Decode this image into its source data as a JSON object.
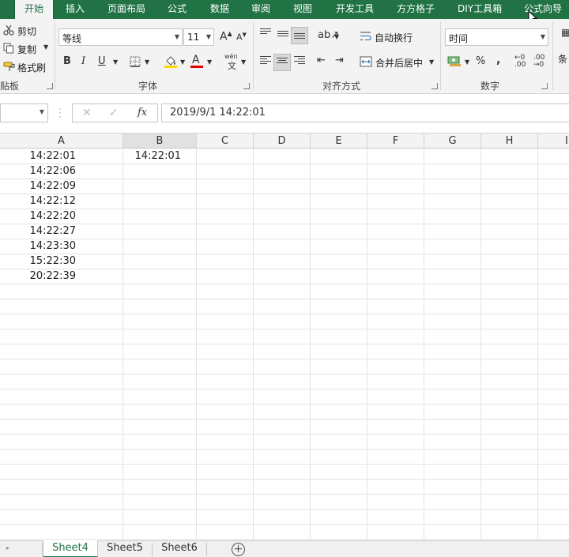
{
  "ribbon_tabs": [
    {
      "label": "开始",
      "active": true
    },
    {
      "label": "插入"
    },
    {
      "label": "页面布局"
    },
    {
      "label": "公式"
    },
    {
      "label": "数据"
    },
    {
      "label": "审阅"
    },
    {
      "label": "视图"
    },
    {
      "label": "开发工具"
    },
    {
      "label": "方方格子"
    },
    {
      "label": "DIY工具箱"
    },
    {
      "label": "公式向导"
    }
  ],
  "clipboard": {
    "cut_label": "剪切",
    "copy_label": "复制",
    "format_painter_label": "格式刷",
    "group_label": "贴板"
  },
  "font": {
    "name": "等线",
    "size": "11",
    "bold": "B",
    "italic": "I",
    "underline": "U",
    "font_color_glyph": "A",
    "phonetic_glyph": "wén",
    "group_label": "字体",
    "fill_color": "#ffd700",
    "text_color": "#e00000"
  },
  "alignment": {
    "wrap_text_label": "自动换行",
    "merge_center_label": "合并后居中",
    "group_label": "对齐方式"
  },
  "number": {
    "format": "时间",
    "percent": "%",
    "comma": ",",
    "group_label": "数字",
    "cond_format_partial": "条"
  },
  "formula_bar": {
    "fx": "fx",
    "formula": "2019/9/1  14:22:01"
  },
  "grid": {
    "columns": [
      "A",
      "B",
      "C",
      "D",
      "E",
      "F",
      "G",
      "H",
      "I"
    ],
    "selected_column": "B",
    "column_a_values": [
      "14:22:01",
      "14:22:06",
      "14:22:09",
      "14:22:12",
      "14:22:20",
      "14:22:27",
      "14:23:30",
      "15:22:30",
      "20:22:39"
    ],
    "b1_value": "14:22:01"
  },
  "sheets": [
    {
      "name": "Sheet4",
      "active": true
    },
    {
      "name": "Sheet5"
    },
    {
      "name": "Sheet6"
    }
  ],
  "colors": {
    "accent": "#217346",
    "ribbon_bg": "#f3f3f3"
  }
}
